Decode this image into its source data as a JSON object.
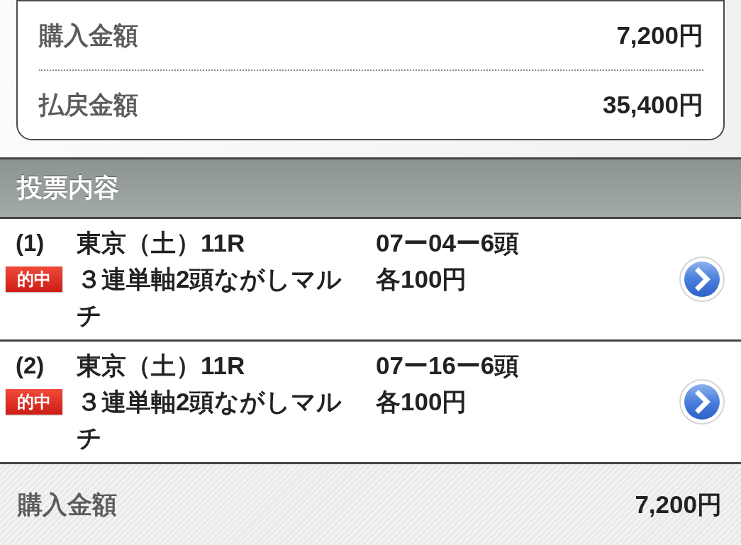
{
  "summary": {
    "rows": [
      {
        "label": "購入金額",
        "value": "7,200円"
      },
      {
        "label": "払戻金額",
        "value": "35,400円"
      }
    ]
  },
  "section": {
    "title": "投票内容"
  },
  "bets": [
    {
      "number": "(1)",
      "badge": "的中",
      "race": "東京（土）11R",
      "bet_type": "３連単軸2頭ながしマルチ",
      "combination": "07ー04ー6頭",
      "amount": "各100円"
    },
    {
      "number": "(2)",
      "badge": "的中",
      "race": "東京（土）11R",
      "bet_type": "３連単軸2頭ながしマルチ",
      "combination": "07ー16ー6頭",
      "amount": "各100円"
    }
  ],
  "footer": {
    "label": "購入金額",
    "value": "7,200円"
  }
}
